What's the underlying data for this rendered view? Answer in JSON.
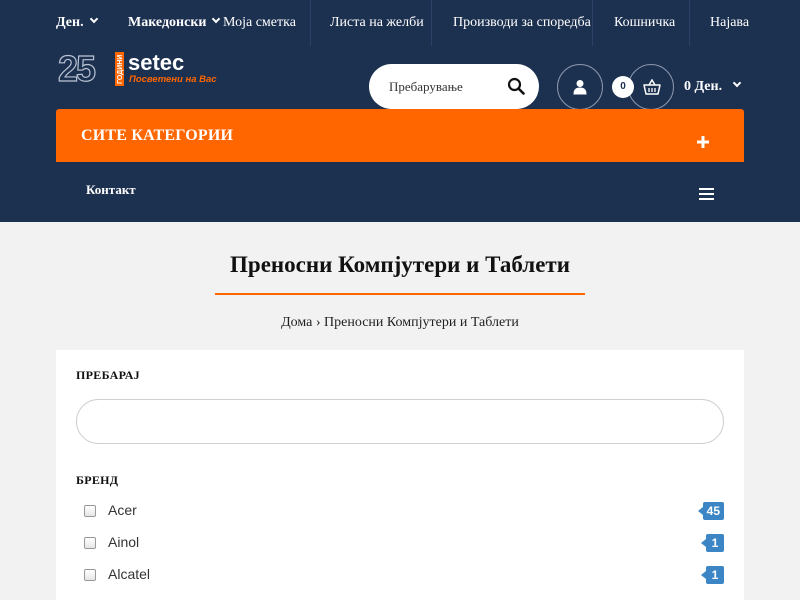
{
  "topbar": {
    "currency": "Ден.",
    "language": "Македонски",
    "links": [
      "Моја сметка",
      "Листа на желби",
      "Производи за споредба",
      "Кошничка",
      "Најава"
    ]
  },
  "logo": {
    "number": "25",
    "vertical_text": "ГОДИНИ",
    "brand": "setec",
    "tagline": "Посветени на Вас"
  },
  "search": {
    "placeholder": "Пребарување"
  },
  "cart": {
    "count": "0",
    "total": "0 Ден."
  },
  "nav": {
    "categories_label": "СИТЕ КАТЕГОРИИ",
    "contact": "Контакт"
  },
  "page": {
    "title": "Преносни Компјутери и Таблети",
    "breadcrumb": "Дома › Преносни Компјутери и Таблети"
  },
  "filters": {
    "search_label": "ПРЕБАРАЈ",
    "search_value": "",
    "brand_label": "БРЕНД",
    "brands": [
      {
        "name": "Acer",
        "count": "45"
      },
      {
        "name": "Ainol",
        "count": "1"
      },
      {
        "name": "Alcatel",
        "count": "1"
      }
    ]
  },
  "colors": {
    "header_bg": "#1c3050",
    "accent": "#ff6600",
    "badge": "#3d86c6"
  },
  "icons": [
    "chevron-down-icon",
    "search-icon",
    "user-icon",
    "basket-icon",
    "plus-icon",
    "hamburger-icon"
  ]
}
